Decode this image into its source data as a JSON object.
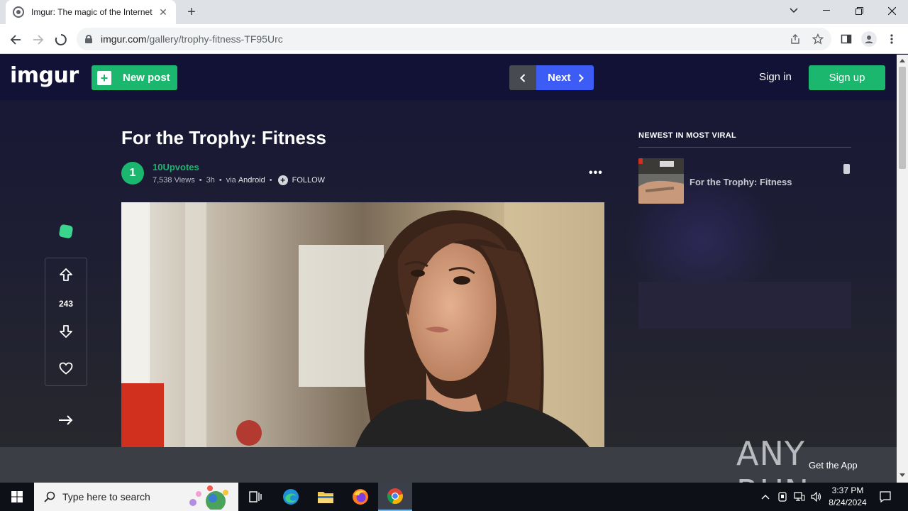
{
  "browser": {
    "tab_title": "Imgur: The magic of the Internet",
    "tab_close": "✕",
    "new_tab": "+",
    "url_host": "imgur.com",
    "url_path": "/gallery/trophy-fitness-TF95Urc"
  },
  "header": {
    "logo": "imgur",
    "new_post": "New post",
    "next": "Next",
    "sign_in": "Sign in",
    "sign_up": "Sign up"
  },
  "post": {
    "title": "For the Trophy: Fitness",
    "avatar_letter": "1",
    "author": "10Upvotes",
    "views": "7,538 Views",
    "age": "3h",
    "via": "via",
    "platform": "Android",
    "follow": "FOLLOW",
    "more": "•••"
  },
  "votes": {
    "score": "243"
  },
  "sidebar": {
    "heading": "NEWEST IN MOST VIRAL",
    "items": [
      {
        "title": "For the Trophy: Fitness"
      }
    ]
  },
  "overlay": {
    "watermark": "ANY RUN",
    "get_app": "Get the App"
  },
  "taskbar": {
    "search_placeholder": "Type here to search",
    "time": "3:37 PM",
    "date": "8/24/2024"
  },
  "colors": {
    "imgur_green": "#1bb76e",
    "next_blue": "#3c5cf5",
    "topbar_bg": "#121237"
  }
}
